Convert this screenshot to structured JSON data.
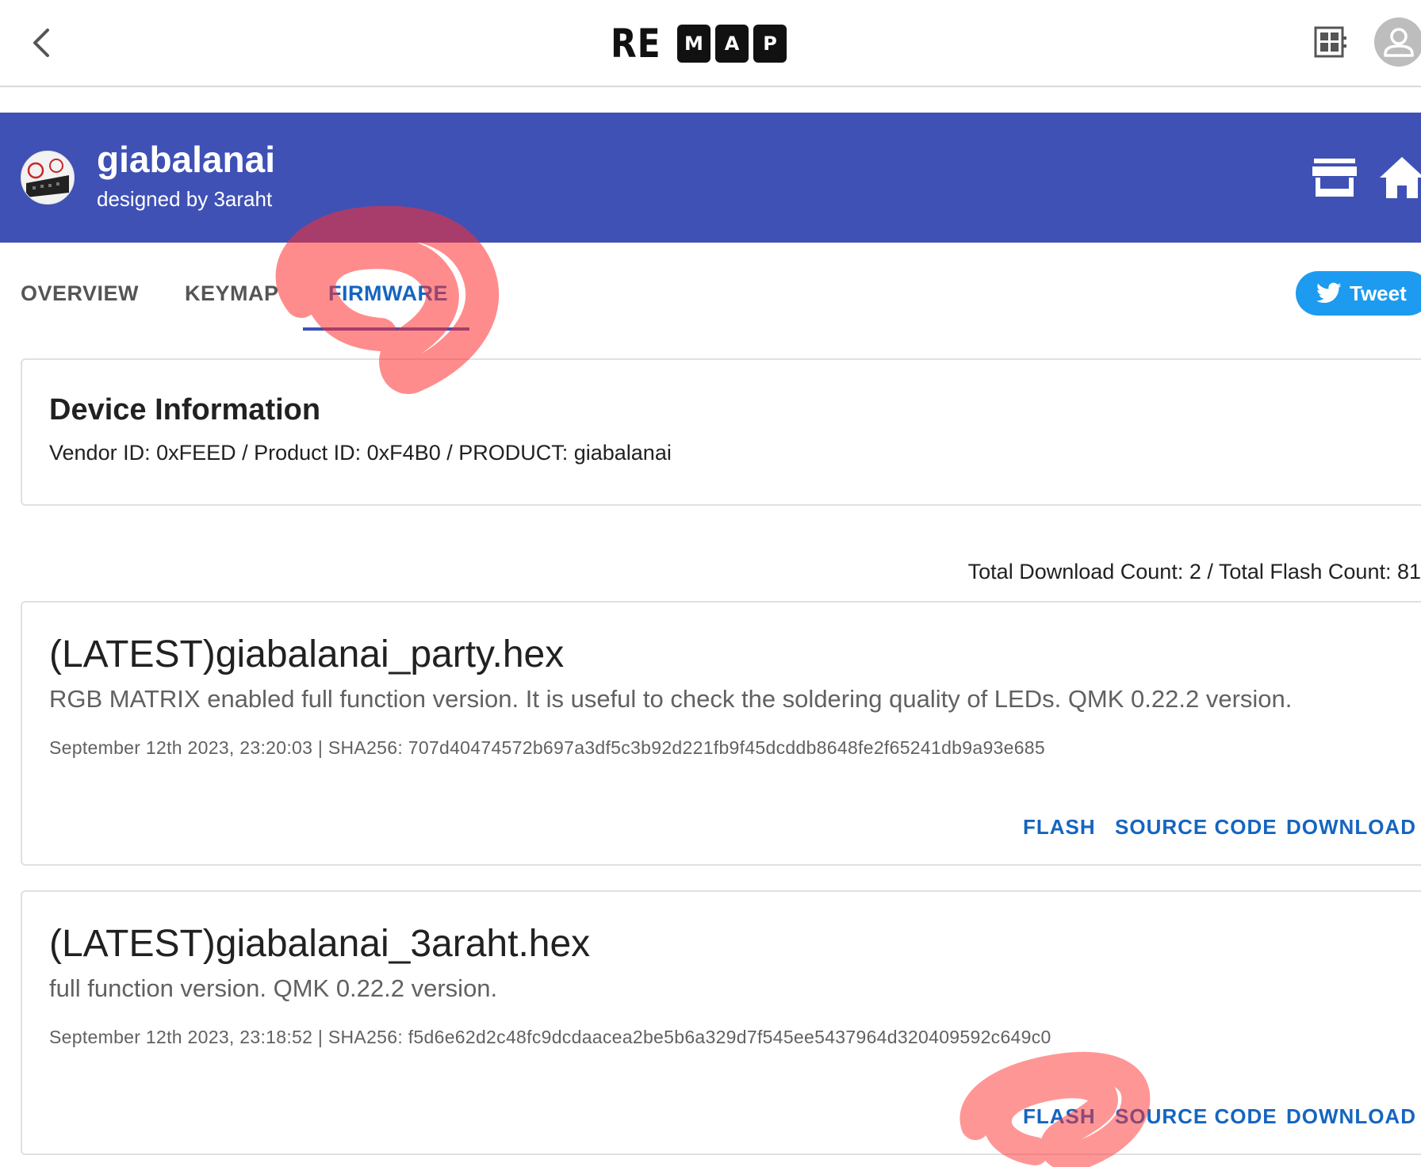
{
  "appbar": {
    "logo_prefix": "RE",
    "logo_letters": [
      "M",
      "A",
      "P"
    ]
  },
  "keyboard": {
    "name": "giabalanai",
    "designer": "designed by 3araht"
  },
  "tabs": [
    {
      "label": "OVERVIEW",
      "active": false
    },
    {
      "label": "KEYMAP",
      "active": false
    },
    {
      "label": "FIRMWARE",
      "active": true
    }
  ],
  "tweet_label": "Tweet",
  "device_info": {
    "title": "Device Information",
    "ids": "Vendor ID: 0xFEED / Product ID: 0xF4B0 / PRODUCT: giabalanai"
  },
  "counts": "Total Download Count: 2 / Total Flash Count: 81",
  "firmwares": [
    {
      "name": "(LATEST)giabalanai_party.hex",
      "description": "RGB MATRIX enabled full function version. It is useful to check the soldering quality of LEDs. QMK 0.22.2 version.",
      "meta": "September 12th 2023, 23:20:03 | SHA256: 707d40474572b697a3df5c3b92d221fb9f45dcddb8648fe2f65241db9a93e685",
      "actions": [
        "FLASH",
        "SOURCE CODE",
        "DOWNLOAD"
      ]
    },
    {
      "name": "(LATEST)giabalanai_3araht.hex",
      "description": "full function version. QMK 0.22.2 version.",
      "meta": "September 12th 2023, 23:18:52 | SHA256: f5d6e62d2c48fc9dcdaacea2be5b6a329d7f545ee5437964d320409592c649c0",
      "actions": [
        "FLASH",
        "SOURCE CODE",
        "DOWNLOAD"
      ]
    }
  ],
  "colors": {
    "header_band": "#3f51b5",
    "active_tab": "#1565c0",
    "tweet": "#1d9bf0",
    "highlight": "#ff3b3b"
  }
}
